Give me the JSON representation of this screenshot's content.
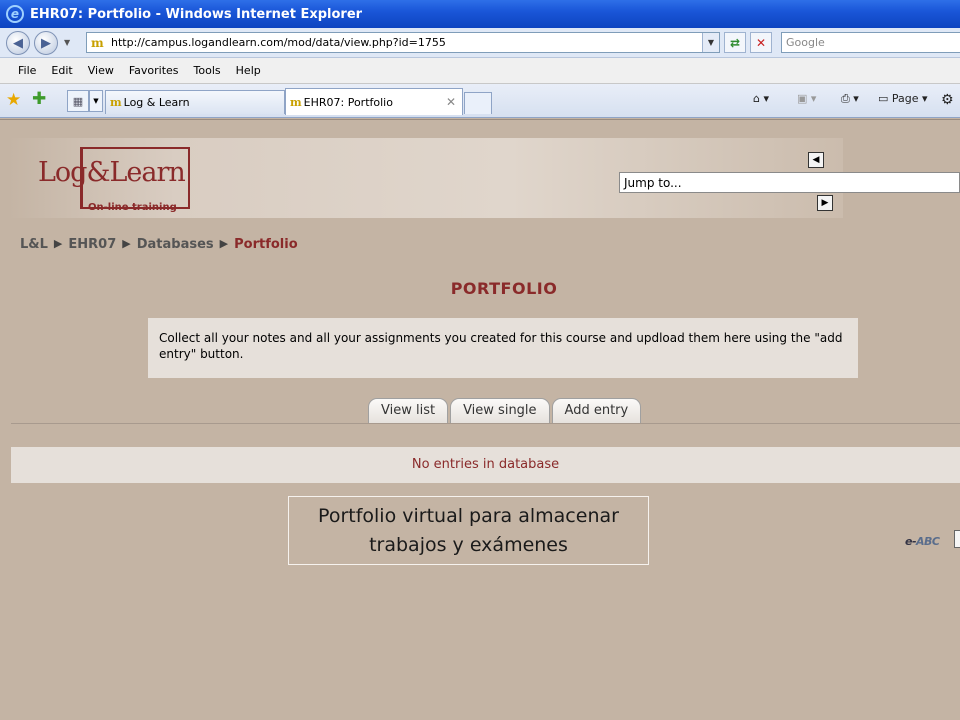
{
  "window": {
    "title": "EHR07: Portfolio - Windows Internet Explorer",
    "address": "http://campus.logandlearn.com/mod/data/view.php?id=1755",
    "search_placeholder": "Google"
  },
  "menu": [
    "File",
    "Edit",
    "View",
    "Favorites",
    "Tools",
    "Help"
  ],
  "tabs": [
    {
      "label": "Log & Learn",
      "active": false
    },
    {
      "label": "EHR07: Portfolio",
      "active": true
    }
  ],
  "commandbar": {
    "page_label": "Page"
  },
  "site": {
    "logo_word": "Log&Learn",
    "logo_sub": "On-line training",
    "jump_to": "Jump to..."
  },
  "breadcrumb": [
    "L&L",
    "EHR07",
    "Databases",
    "Portfolio"
  ],
  "page_title": "PORTFOLIO",
  "intro_text": "Collect all your notes and all your assignments you created for this course and updload them here using the \"add entry\" button.",
  "view_tabs": [
    "View list",
    "View single",
    "Add entry"
  ],
  "no_entries": "No entries in database",
  "caption": "Portfolio virtual para almacenar trabajos y exámenes",
  "footer_logo": {
    "prefix": "e-",
    "brand": "ABC"
  },
  "colors": {
    "accent": "#8a2a2a",
    "page_bg": "#c4b4a4",
    "panel_bg": "#e6e0da",
    "ie_blue": "#1a56d8"
  }
}
